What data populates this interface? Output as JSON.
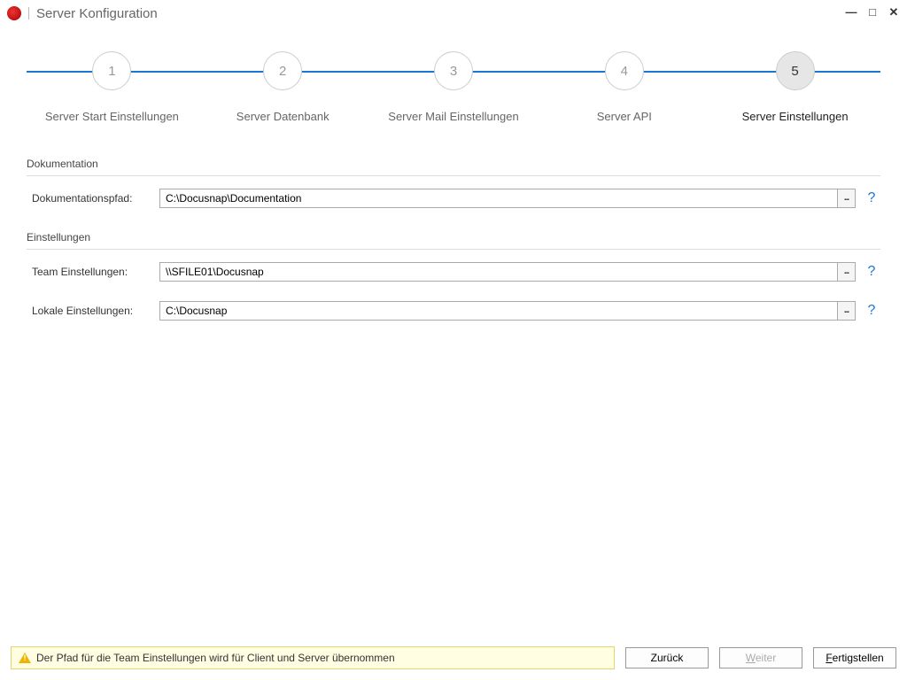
{
  "window": {
    "title": "Server Konfiguration"
  },
  "wizard": {
    "steps": [
      {
        "num": "1",
        "label": "Server Start Einstellungen"
      },
      {
        "num": "2",
        "label": "Server Datenbank"
      },
      {
        "num": "3",
        "label": "Server Mail Einstellungen"
      },
      {
        "num": "4",
        "label": "Server API"
      },
      {
        "num": "5",
        "label": "Server Einstellungen"
      }
    ],
    "active_index": 4
  },
  "sections": {
    "doc_title": "Dokumentation",
    "settings_title": "Einstellungen"
  },
  "fields": {
    "doc_path_label": "Dokumentationspfad:",
    "doc_path_value": "C:\\Docusnap\\Documentation",
    "team_label": "Team Einstellungen:",
    "team_value": "\\\\SFILE01\\Docusnap",
    "local_label": "Lokale Einstellungen:",
    "local_value": "C:\\Docusnap"
  },
  "footer": {
    "warning": "Der Pfad für die Team Einstellungen wird für Client und Server übernommen",
    "back": "Zurück",
    "next_prefix": "W",
    "next_rest": "eiter",
    "finish_prefix": "F",
    "finish_rest": "ertigstellen"
  },
  "glyphs": {
    "help": "?",
    "minimize": "—",
    "maximize": "□",
    "close": "✕"
  }
}
